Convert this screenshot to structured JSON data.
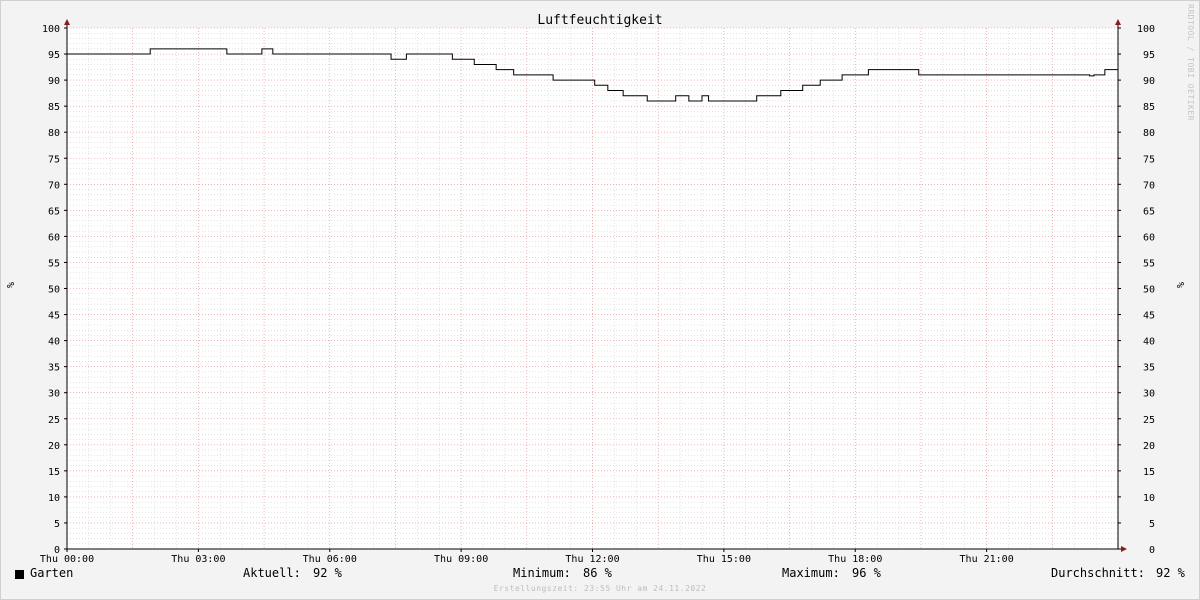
{
  "chart_data": {
    "type": "line",
    "title": "Luftfeuchtigkeit",
    "ylabel": "%",
    "ylim": [
      0,
      100
    ],
    "yticks": [
      0,
      5,
      10,
      15,
      20,
      25,
      30,
      35,
      40,
      45,
      50,
      55,
      60,
      65,
      70,
      75,
      80,
      85,
      90,
      95,
      100
    ],
    "xlim_hours": [
      0,
      24
    ],
    "xtick_hours": [
      0,
      3,
      6,
      9,
      12,
      15,
      18,
      21
    ],
    "xtick_labels": [
      "Thu 00:00",
      "Thu 03:00",
      "Thu 06:00",
      "Thu 09:00",
      "Thu 12:00",
      "Thu 15:00",
      "Thu 18:00",
      "Thu 21:00"
    ],
    "grid": true,
    "series": [
      {
        "name": "Garten",
        "color": "#000000",
        "x_hours": [
          0.0,
          1.9,
          3.65,
          4.45,
          4.7,
          7.4,
          7.75,
          8.8,
          9.3,
          9.8,
          10.2,
          11.1,
          12.05,
          12.35,
          12.7,
          13.25,
          13.9,
          14.2,
          14.5,
          14.65,
          15.75,
          16.3,
          16.8,
          17.2,
          17.7,
          18.3,
          19.45,
          23.35,
          23.45,
          23.7,
          24.0
        ],
        "values": [
          95,
          96,
          95,
          96,
          95,
          94,
          95,
          94,
          93,
          92,
          91,
          90,
          89,
          88,
          87,
          86,
          87,
          86,
          87,
          86,
          87,
          88,
          89,
          90,
          91,
          92,
          91,
          90.8,
          91,
          92,
          92
        ]
      }
    ]
  },
  "legend": {
    "series_name": "Garten",
    "current_label": "Aktuell:",
    "current_value": "92 %",
    "min_label": "Minimum:",
    "min_value": "86 %",
    "max_label": "Maximum:",
    "max_value": "96 %",
    "avg_label": "Durchschnitt:",
    "avg_value": "92 %"
  },
  "footer": "Erstellungszeit: 23:55 Uhr am 24.11.2022",
  "watermark": "RRDTOOL / TOBI OETIKER",
  "colors": {
    "background": "#f3f3f3",
    "canvas": "#ffffff",
    "major_grid": "#e08a8a",
    "minor_grid": "#c8c8c8",
    "axis": "#000000",
    "arrow": "#8b1a1a"
  }
}
